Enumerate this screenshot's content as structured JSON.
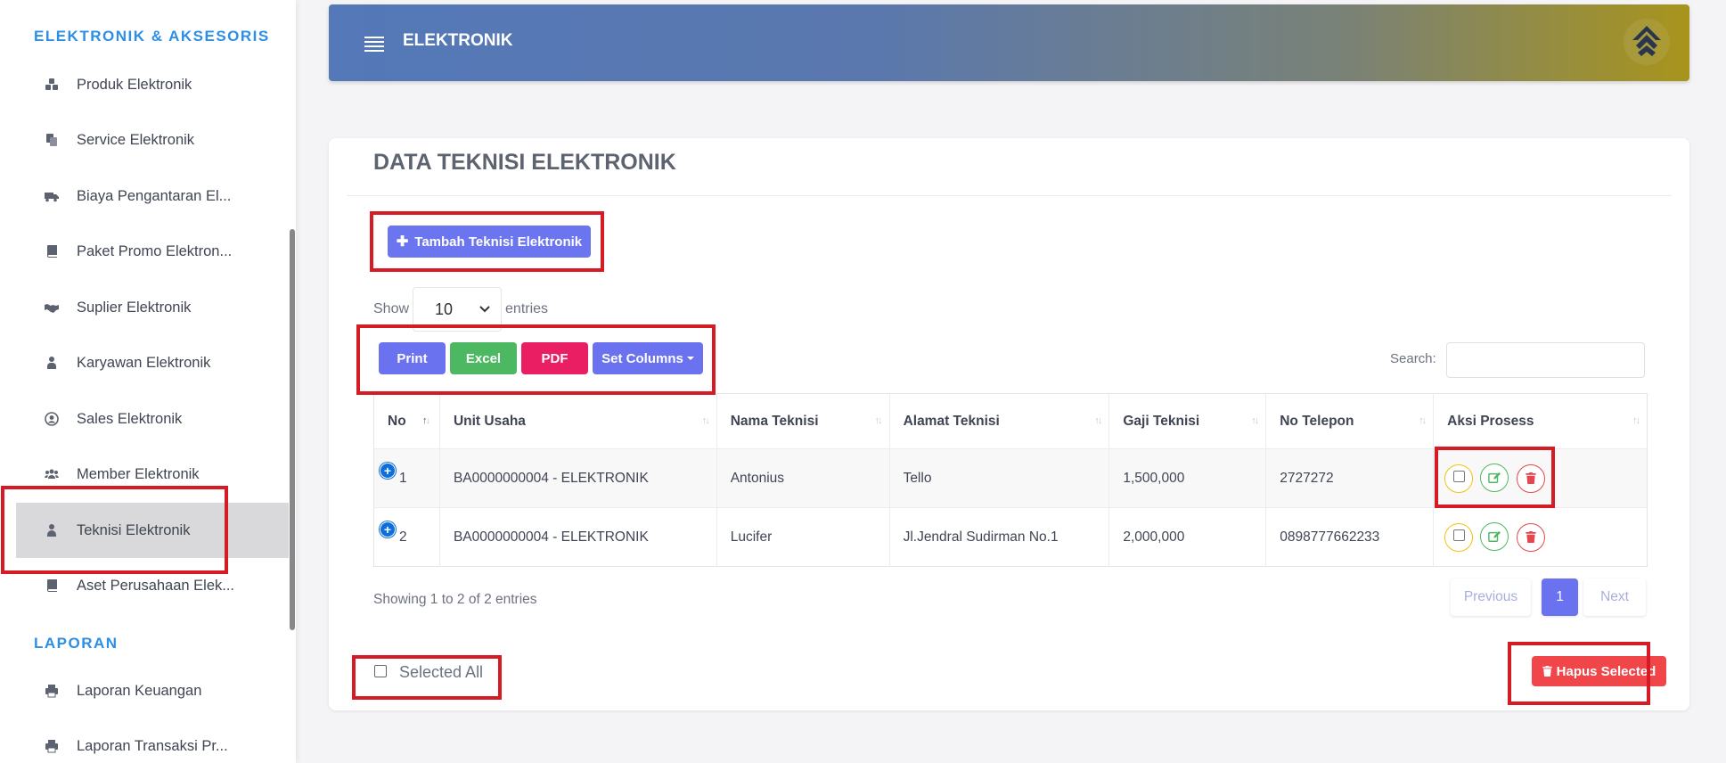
{
  "sidebar": {
    "section_elektronik": "ELEKTRONIK & AKSESORIS",
    "section_laporan": "LAPORAN",
    "items": [
      {
        "label": "Produk Elektronik",
        "icon": "cubes-icon"
      },
      {
        "label": "Service Elektronik",
        "icon": "copy-icon"
      },
      {
        "label": "Biaya Pengantaran El...",
        "icon": "truck-icon"
      },
      {
        "label": "Paket Promo Elektron...",
        "icon": "book-icon"
      },
      {
        "label": "Suplier Elektronik",
        "icon": "handshake-icon"
      },
      {
        "label": "Karyawan Elektronik",
        "icon": "user-tie-icon"
      },
      {
        "label": "Sales Elektronik",
        "icon": "user-circle-icon"
      },
      {
        "label": "Member Elektronik",
        "icon": "users-icon"
      },
      {
        "label": "Teknisi Elektronik",
        "icon": "user-icon",
        "active": true
      },
      {
        "label": "Aset Perusahaan Elek...",
        "icon": "book-icon"
      }
    ],
    "laporan_items": [
      {
        "label": "Laporan Keuangan",
        "icon": "print-icon"
      },
      {
        "label": "Laporan Transaksi Pr...",
        "icon": "print-icon"
      }
    ]
  },
  "header": {
    "title": "ELEKTRONIK"
  },
  "main": {
    "title": "DATA TEKNISI ELEKTRONIK",
    "add_button": "Tambah Teknisi Elektronik",
    "show_label": "Show",
    "entries_label": "entries",
    "page_length": "10",
    "export_buttons": {
      "print": "Print",
      "excel": "Excel",
      "pdf": "PDF",
      "columns": "Set Columns"
    },
    "search_label": "Search:",
    "search_value": "",
    "table": {
      "headers": [
        "No",
        "Unit Usaha",
        "Nama Teknisi",
        "Alamat Teknisi",
        "Gaji Teknisi",
        "No Telepon",
        "Aksi Prosess"
      ],
      "rows": [
        {
          "no": "1",
          "unit": "BA0000000004 - ELEKTRONIK",
          "nama": "Antonius",
          "alamat": "Tello",
          "gaji": "1,500,000",
          "telepon": "2727272"
        },
        {
          "no": "2",
          "unit": "BA0000000004 - ELEKTRONIK",
          "nama": "Lucifer",
          "alamat": "Jl.Jendral Sudirman No.1",
          "gaji": "2,000,000",
          "telepon": "0898777662233"
        }
      ]
    },
    "info": "Showing 1 to 2 of 2 entries",
    "pagination": {
      "previous": "Previous",
      "current": "1",
      "next": "Next"
    },
    "selected_all_label": "Selected All",
    "delete_selected_button": "Hapus Selected"
  },
  "colors": {
    "primary": "#6b72ef",
    "success": "#4cb862",
    "pdf": "#e91e63",
    "danger": "#f0464a",
    "highlight": "#d61b24",
    "sidebar_section": "#2d8ee6"
  }
}
